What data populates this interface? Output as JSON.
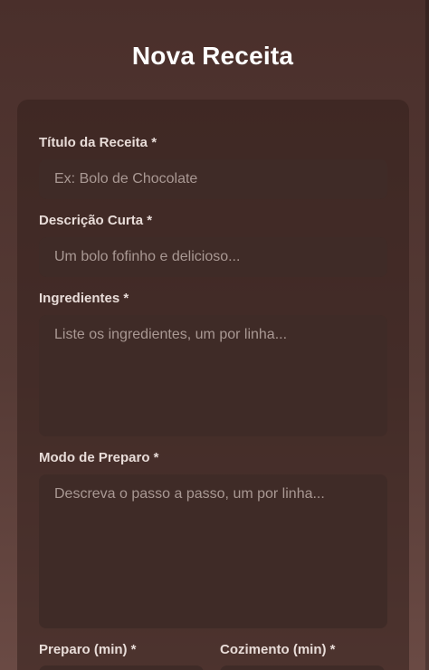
{
  "header": {
    "title": "Nova Receita"
  },
  "form": {
    "titulo": {
      "label": "Título da Receita *",
      "placeholder": "Ex: Bolo de Chocolate"
    },
    "descricao": {
      "label": "Descrição Curta *",
      "placeholder": "Um bolo fofinho e delicioso..."
    },
    "ingredientes": {
      "label": "Ingredientes *",
      "placeholder": "Liste os ingredientes, um por linha..."
    },
    "modo_preparo": {
      "label": "Modo de Preparo *",
      "placeholder": "Descreva o passo a passo, um por linha..."
    },
    "preparo": {
      "label": "Preparo (min) *"
    },
    "cozimento": {
      "label": "Cozimento (min) *"
    }
  },
  "colors": {
    "background": "#4a2f2b",
    "card": "#3a2522",
    "input": "#3f2b27",
    "title": "#ffffff",
    "label": "#e8dcd8",
    "placeholder": "#a99893"
  }
}
